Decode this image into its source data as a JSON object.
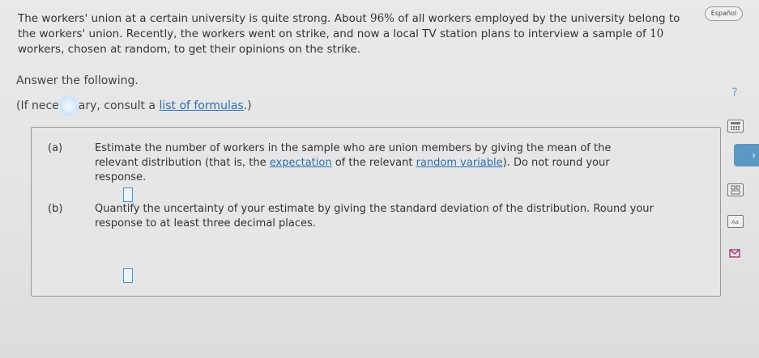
{
  "problem": {
    "line1": "The workers' union at a certain university is quite strong. About ",
    "percent": "96%",
    "line1b": " of all workers employed by the university belong to the workers' union. Recently, the workers went on strike, and now a local TV station plans to interview a sample of ",
    "n": "10",
    "line1c": " workers, chosen at random, to get their opinions on the strike."
  },
  "answer_prompt": "Answer the following.",
  "formula_note": {
    "prefix": "(If nece",
    "middle": "ary, consult a ",
    "link": "list of formulas",
    "suffix": ".)"
  },
  "part_a": {
    "label": "(a)",
    "text1": "Estimate the number of workers in the sample who are union members by giving the mean of the relevant distribution (that is, the ",
    "link1": "expectation",
    "text2": " of the relevant ",
    "link2": "random variable",
    "text3": "). Do not round your response.",
    "answer_value": ""
  },
  "part_b": {
    "label": "(b)",
    "text": "Quantify the uncertainty of your estimate by giving the standard deviation of the distribution. Round your response to at least three decimal places.",
    "answer_value": ""
  },
  "sidebar": {
    "espanol": "Español",
    "help": "?",
    "tab_arrow": "›"
  },
  "icons": [
    "calculator-icon",
    "periodic-table-icon",
    "glossary-icon",
    "mail-icon"
  ]
}
